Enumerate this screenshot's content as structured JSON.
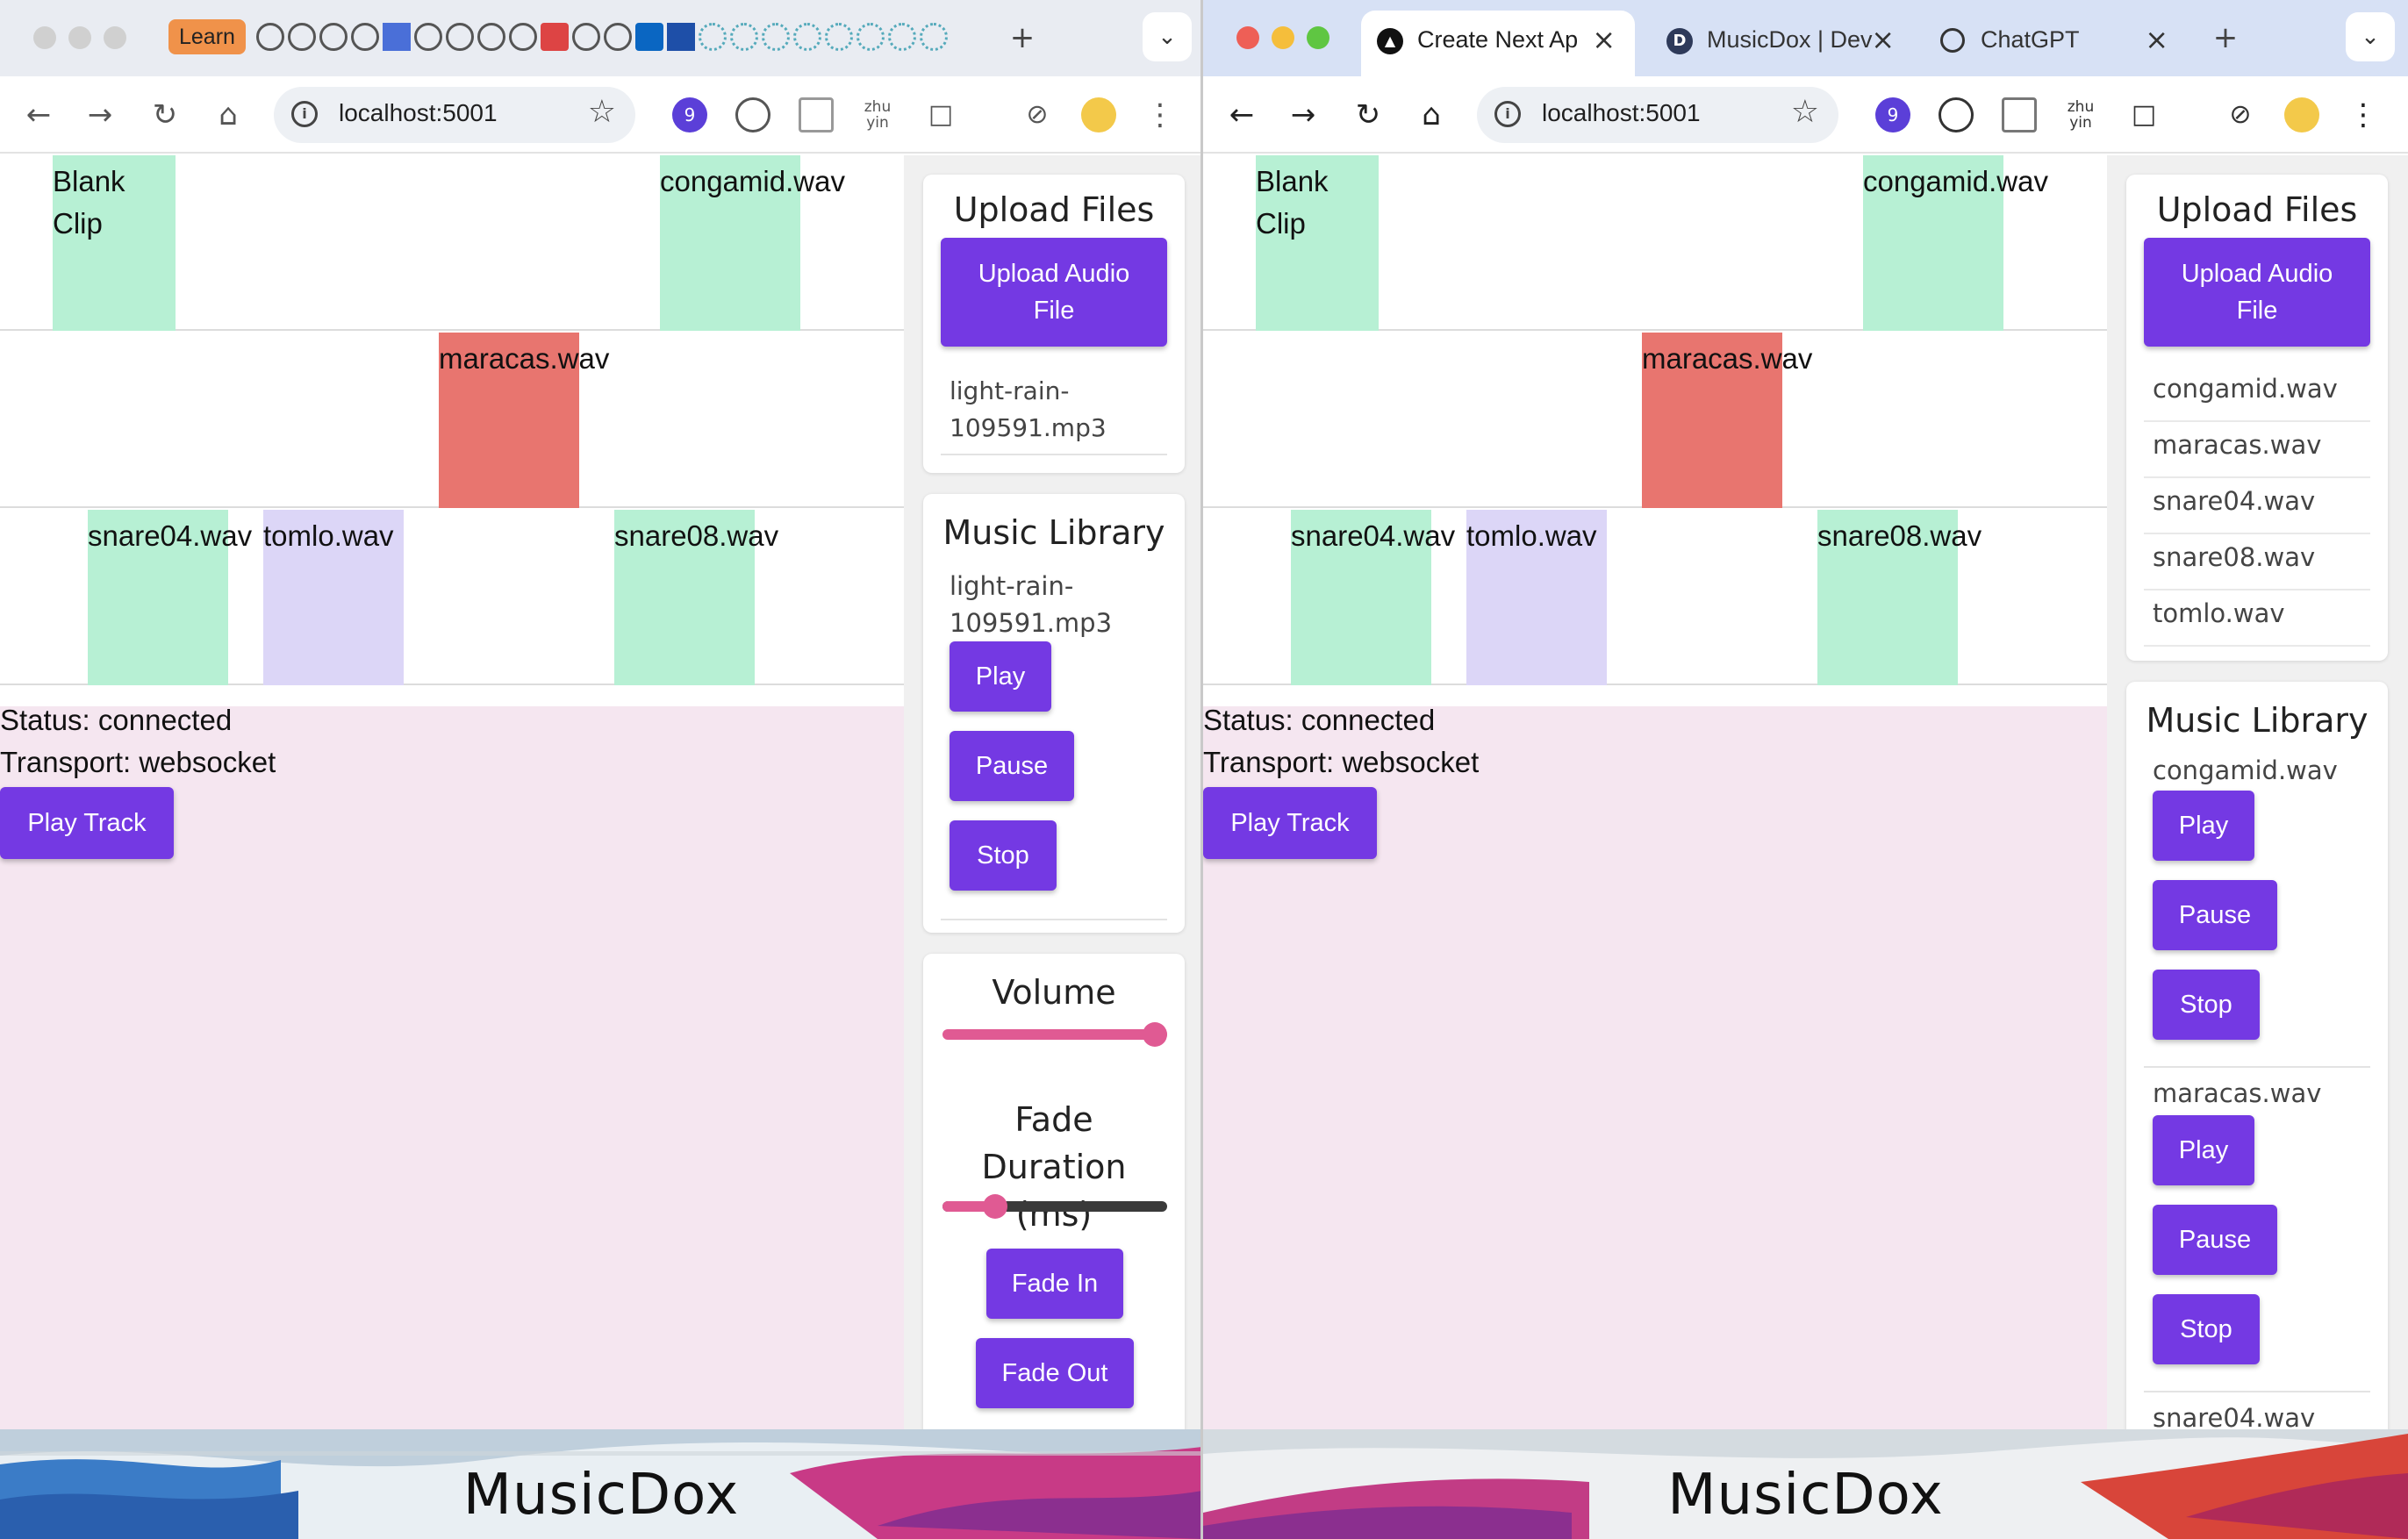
{
  "windows": {
    "left": {
      "tabs": {
        "learn_label": "Learn"
      },
      "address": "localhost:5001",
      "ext_badge": "9",
      "ext_zhuyin": "zhu yin",
      "timeline": {
        "lane1": [
          {
            "label": "Blank Clip"
          },
          {
            "label": "congamid.wav"
          }
        ],
        "lane2": [
          {
            "label": "maracas.wav"
          }
        ],
        "lane3": [
          {
            "label": "snare04.wav"
          },
          {
            "label": "tomlo.wav"
          },
          {
            "label": "snare08.wav"
          }
        ]
      },
      "status": {
        "connection": "Status: connected",
        "transport": "Transport: websocket",
        "play_track": "Play Track"
      },
      "upload": {
        "title": "Upload Files",
        "button": "Upload Audio File",
        "files": [
          "light-rain-109591.mp3"
        ]
      },
      "library": {
        "title": "Music Library",
        "items": [
          {
            "name": "light-rain-109591.mp3",
            "play": "Play",
            "pause": "Pause",
            "stop": "Stop"
          }
        ]
      },
      "volume": {
        "title": "Volume",
        "level": 1.0
      },
      "fade": {
        "title": "Fade Duration (ms)",
        "level": 0.2,
        "fade_in": "Fade In",
        "fade_out": "Fade Out"
      },
      "footer": "MusicDox"
    },
    "right": {
      "tabs": [
        {
          "label": "Create Next Ap",
          "icon": "triangle-icon"
        },
        {
          "label": "MusicDox | Dev",
          "icon": "d-logo-icon"
        },
        {
          "label": "ChatGPT",
          "icon": "openai-icon"
        }
      ],
      "address": "localhost:5001",
      "ext_badge": "9",
      "ext_zhuyin": "zhu yin",
      "timeline": {
        "lane1": [
          {
            "label": "Blank Clip"
          },
          {
            "label": "congamid.wav"
          }
        ],
        "lane2": [
          {
            "label": "maracas.wav"
          }
        ],
        "lane3": [
          {
            "label": "snare04.wav"
          },
          {
            "label": "tomlo.wav"
          },
          {
            "label": "snare08.wav"
          }
        ]
      },
      "status": {
        "connection": "Status: connected",
        "transport": "Transport: websocket",
        "play_track": "Play Track"
      },
      "upload": {
        "title": "Upload Files",
        "button": "Upload Audio File",
        "files": [
          "congamid.wav",
          "maracas.wav",
          "snare04.wav",
          "snare08.wav",
          "tomlo.wav"
        ]
      },
      "library": {
        "title": "Music Library",
        "items": [
          {
            "name": "congamid.wav",
            "play": "Play",
            "pause": "Pause",
            "stop": "Stop"
          },
          {
            "name": "maracas.wav",
            "play": "Play",
            "pause": "Pause",
            "stop": "Stop"
          },
          {
            "name": "snare04.wav"
          }
        ]
      },
      "footer": "MusicDox"
    }
  },
  "colors": {
    "accent": "#7439e3",
    "clip_green": "#b7f0d4",
    "clip_red": "#e8756f",
    "clip_lavender": "#dcd6f7",
    "slider_pink": "#e05a93",
    "lower_pane": "#f5e6f0"
  }
}
